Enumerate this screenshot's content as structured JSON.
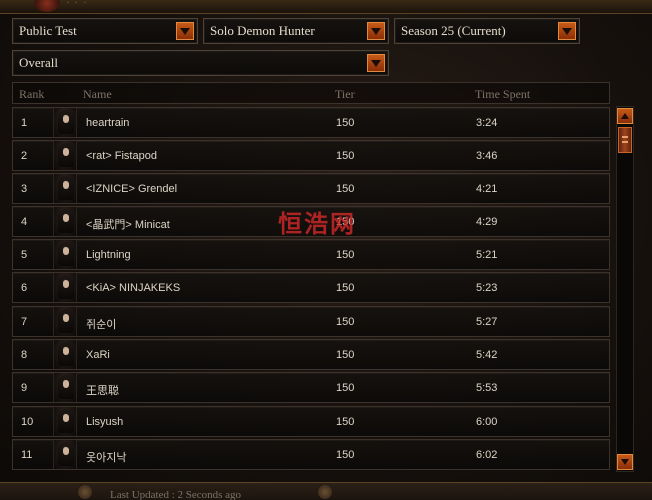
{
  "filters": {
    "region": "Public Test",
    "category": "Solo Demon Hunter",
    "season": "Season 25 (Current)",
    "scope": "Overall"
  },
  "table": {
    "headers": {
      "rank": "Rank",
      "name": "Name",
      "tier": "Tier",
      "time": "Time Spent"
    },
    "rows": [
      {
        "rank": "1",
        "name": "heartrain",
        "tier": "150",
        "time": "3:24"
      },
      {
        "rank": "2",
        "name": "<rat> Fistapod",
        "tier": "150",
        "time": "3:46"
      },
      {
        "rank": "3",
        "name": "<IZNICE> Grendel",
        "tier": "150",
        "time": "4:21"
      },
      {
        "rank": "4",
        "name": "<晶武門> Minicat",
        "tier": "150",
        "time": "4:29"
      },
      {
        "rank": "5",
        "name": "Lightning",
        "tier": "150",
        "time": "5:21"
      },
      {
        "rank": "6",
        "name": "<KiA> NINJAKEKS",
        "tier": "150",
        "time": "5:23"
      },
      {
        "rank": "7",
        "name": "쥐순이",
        "tier": "150",
        "time": "5:27"
      },
      {
        "rank": "8",
        "name": "XaRi",
        "tier": "150",
        "time": "5:42"
      },
      {
        "rank": "9",
        "name": "王思聪",
        "tier": "150",
        "time": "5:53"
      },
      {
        "rank": "10",
        "name": "Lisyush",
        "tier": "150",
        "time": "6:00"
      },
      {
        "rank": "11",
        "name": "옷아지낙",
        "tier": "150",
        "time": "6:02"
      }
    ]
  },
  "footer": {
    "last_updated": "Last Updated : 2 Seconds ago"
  },
  "watermark": "恒浩网",
  "colors": {
    "accent": "#c85a18",
    "panel_border": "#4d4236",
    "text": "#ddd5c6"
  }
}
